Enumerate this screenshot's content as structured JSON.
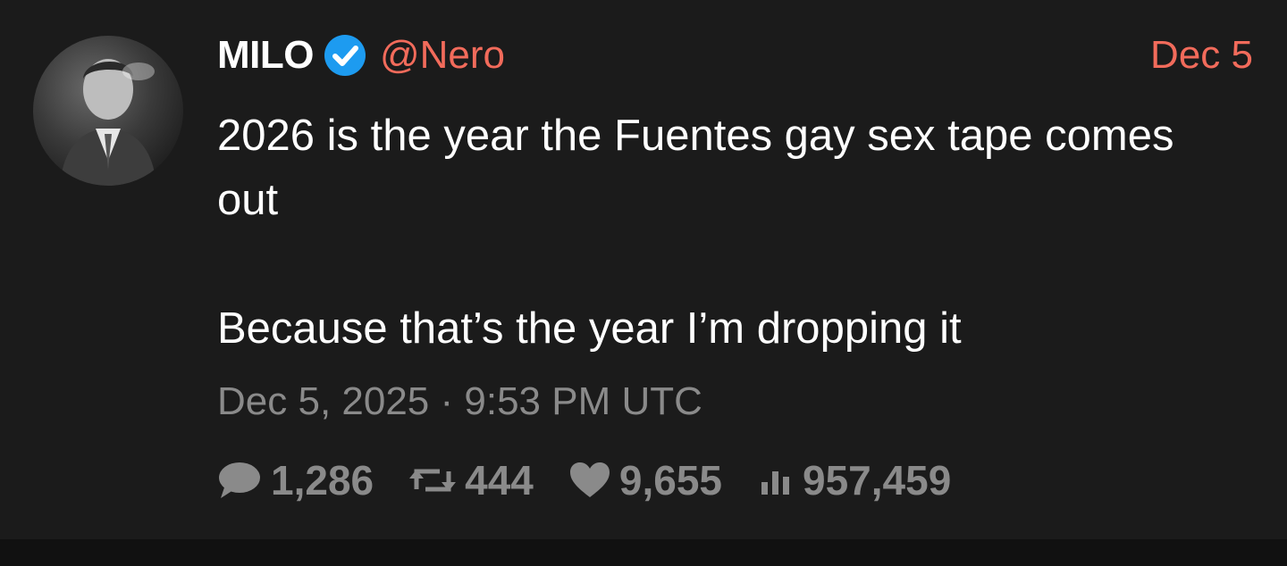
{
  "tweet": {
    "author": {
      "display_name": "MILO",
      "handle": "@Nero",
      "verified": true,
      "avatar_icon": "avatar-photo"
    },
    "date_short": "Dec 5",
    "body": {
      "line1": "2026 is the year the Fuentes gay sex tape comes out",
      "line2": "Because that’s the year I’m dropping it"
    },
    "timestamp": "Dec 5, 2025 · 9:53 PM UTC",
    "stats": {
      "replies": "1,286",
      "retweets": "444",
      "likes": "9,655",
      "views": "957,459"
    }
  },
  "colors": {
    "background": "#1b1b1b",
    "accent": "#f26b5b",
    "verified_badge": "#1d9bf0",
    "muted_text": "#8a8a8a",
    "primary_text": "#ffffff"
  },
  "icons": {
    "verified": "verified-badge-icon",
    "replies": "comment-bubble-icon",
    "retweets": "retweet-icon",
    "likes": "heart-icon",
    "views": "bar-chart-icon"
  }
}
